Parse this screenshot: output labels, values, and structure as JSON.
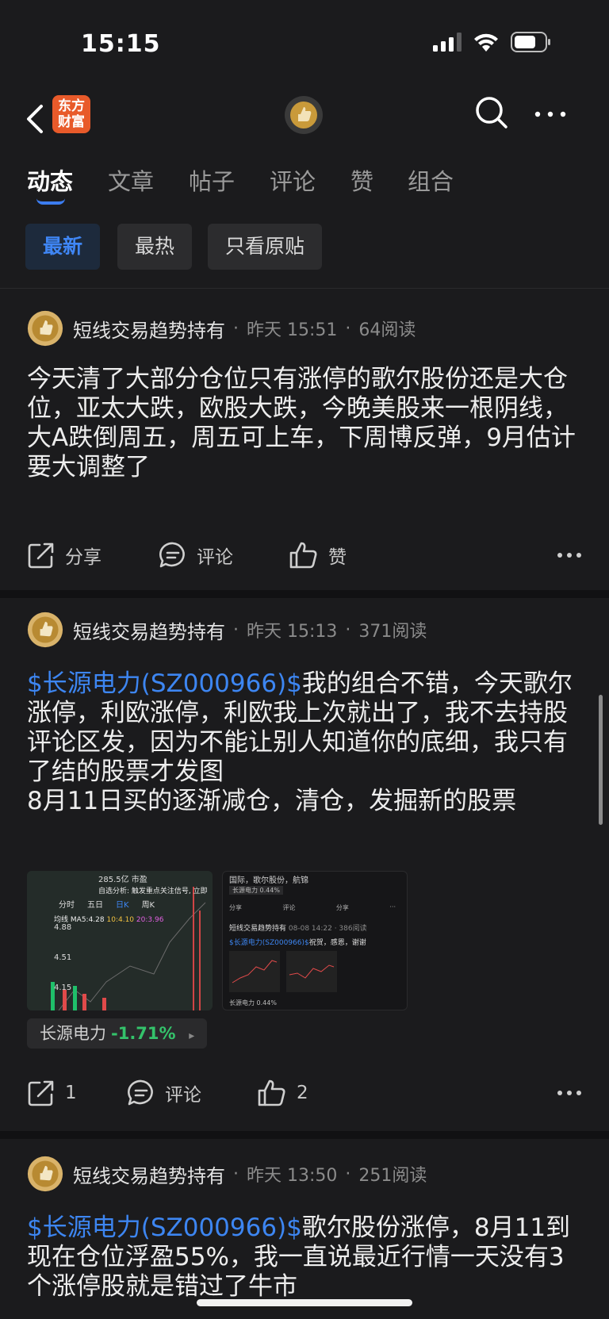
{
  "status_bar": {
    "time": "15:15",
    "battery_level": 0.7
  },
  "nav": {
    "logo_line1": "东方",
    "logo_line2": "财富"
  },
  "tabs": [
    {
      "label": "动态",
      "active": true
    },
    {
      "label": "文章"
    },
    {
      "label": "帖子"
    },
    {
      "label": "评论"
    },
    {
      "label": "赞"
    },
    {
      "label": "组合"
    }
  ],
  "filters": [
    {
      "label": "最新",
      "active": true
    },
    {
      "label": "最热"
    },
    {
      "label": "只看原贴"
    }
  ],
  "posts": [
    {
      "author": "短线交易趋势持有",
      "time": "昨天 15:51",
      "reads": "64阅读",
      "stock_link": "",
      "text": "今天清了大部分仓位只有涨停的歌尔股份还是大仓位，亚太大跌，欧股大跌，今晚美股来一根阴线，大A跌倒周五，周五可上车，下周博反弹，9月估计要大调整了",
      "share_label": "分享",
      "comment_label": "评论",
      "like_label": "赞"
    },
    {
      "author": "短线交易趋势持有",
      "time": "昨天 15:13",
      "reads": "371阅读",
      "stock_link": "$长源电力(SZ000966)$",
      "text": "我的组合不错，今天歌尔涨停，利欧涨停，利欧我上次就出了，我不去持股评论区发，因为不能让别人知道你的底细，我只有了结的股票才发图",
      "text2": "8月11日买的逐渐减仓，清仓，发掘新的股票",
      "image1": {
        "top_text": "285.5亿  市盈",
        "alert": "自选分析: 触发重点关注信号, 立即",
        "tabs": [
          "分时",
          "五日",
          "日K",
          "周K"
        ],
        "active_tab": "日K",
        "prices": [
          "4.88",
          "4.51",
          "4.15"
        ],
        "ma_label": "均线",
        "ma_value": "MA5:4.28",
        "ma10": "10:4.10",
        "ma20": "20:3.96"
      },
      "image2": {
        "tags": "国际，歌尔股份，航锦",
        "stock_mini": "长源电力 0.44%",
        "share": "分享",
        "comment": "评论",
        "like": "分享",
        "author": "短线交易趋势持有",
        "meta": "08-08 14:22 · 386阅读",
        "link": "$长源电力(SZ000966)$",
        "text": "祝贺，感恩，谢谢",
        "stock_mini2": "长源电力 0.44%"
      },
      "stock_tag": {
        "name": "长源电力",
        "change": "-1.71%"
      },
      "share_count": "1",
      "comment_label": "评论",
      "like_count": "2"
    },
    {
      "author": "短线交易趋势持有",
      "time": "昨天 13:50",
      "reads": "251阅读",
      "stock_link": "$长源电力(SZ000966)$",
      "text": "歌尔股份涨停，8月11到现在仓位浮盈55%，我一直说最近行情一天没有3个涨停股就是错过了牛市"
    }
  ],
  "colors": {
    "accent": "#3d86f2",
    "down": "#34c36b",
    "background": "#1b1b1d"
  }
}
